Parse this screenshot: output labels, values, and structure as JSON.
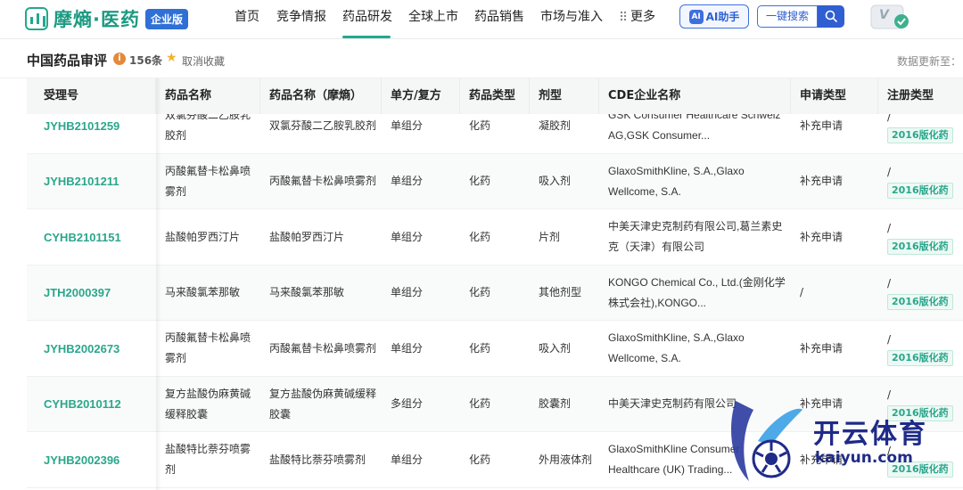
{
  "nav": {
    "logo_text": "摩熵·医药",
    "logo_badge": "企业版",
    "items": [
      "首页",
      "竞争情报",
      "药品研发",
      "全球上市",
      "药品销售",
      "市场与准入"
    ],
    "more": "更多",
    "ai_label": "AI助手",
    "search_label": "一键搜索",
    "vip_label": "V"
  },
  "header": {
    "title": "中国药品审评",
    "count": "156条",
    "unfav": "取消收藏",
    "updated": "数据更新至："
  },
  "columns": [
    "受理号",
    "药品名称",
    "药品名称（摩熵）",
    "单方/复方",
    "药品类型",
    "剂型",
    "CDE企业名称",
    "申请类型",
    "注册类型"
  ],
  "rows": [
    {
      "id": "JYHB2101259",
      "name": "双氯芬酸二乙胺乳胶剂",
      "name_ms": "双氯芬酸二乙胺乳胶剂",
      "combo": "单组分",
      "type": "化药",
      "form": "凝胶剂",
      "company": "GSK Consumer Healthcare Schweiz AG,GSK Consumer...",
      "apply": "补充申请",
      "reg": "/",
      "reg_tag": "2016版化药"
    },
    {
      "id": "JYHB2101211",
      "name": "丙酸氟替卡松鼻喷雾剂",
      "name_ms": "丙酸氟替卡松鼻喷雾剂",
      "combo": "单组分",
      "type": "化药",
      "form": "吸入剂",
      "company": "GlaxoSmithKline, S.A.,Glaxo Wellcome, S.A.",
      "apply": "补充申请",
      "reg": "/",
      "reg_tag": "2016版化药"
    },
    {
      "id": "CYHB2101151",
      "name": "盐酸帕罗西汀片",
      "name_ms": "盐酸帕罗西汀片",
      "combo": "单组分",
      "type": "化药",
      "form": "片剂",
      "company": "中美天津史克制药有限公司,葛兰素史克（天津）有限公司",
      "apply": "补充申请",
      "reg": "/",
      "reg_tag": "2016版化药"
    },
    {
      "id": "JTH2000397",
      "name": "马来酸氯苯那敏",
      "name_ms": "马来酸氯苯那敏",
      "combo": "单组分",
      "type": "化药",
      "form": "其他剂型",
      "company": "KONGO Chemical Co., Ltd.(金刚化学株式会社),KONGO...",
      "apply": "/",
      "reg": "/",
      "reg_tag": "2016版化药"
    },
    {
      "id": "JYHB2002673",
      "name": "丙酸氟替卡松鼻喷雾剂",
      "name_ms": "丙酸氟替卡松鼻喷雾剂",
      "combo": "单组分",
      "type": "化药",
      "form": "吸入剂",
      "company": "GlaxoSmithKline, S.A.,Glaxo Wellcome, S.A.",
      "apply": "补充申请",
      "reg": "/",
      "reg_tag": "2016版化药"
    },
    {
      "id": "CYHB2010112",
      "name": "复方盐酸伪麻黄碱缓释胶囊",
      "name_ms": "复方盐酸伪麻黄碱缓释胶囊",
      "combo": "多组分",
      "type": "化药",
      "form": "胶囊剂",
      "company": "中美天津史克制药有限公司",
      "apply": "补充申请",
      "reg": "/",
      "reg_tag": "2016版化药"
    },
    {
      "id": "JYHB2002396",
      "name": "盐酸特比萘芬喷雾剂",
      "name_ms": "盐酸特比萘芬喷雾剂",
      "combo": "单组分",
      "type": "化药",
      "form": "外用液体剂",
      "company": "GlaxoSmithKline Consumer Healthcare (UK) Trading...",
      "apply": "补充申请",
      "reg": "/",
      "reg_tag": "2016版化药"
    }
  ],
  "watermark": {
    "cn": "开云体育",
    "en": "kaiyun.com"
  }
}
